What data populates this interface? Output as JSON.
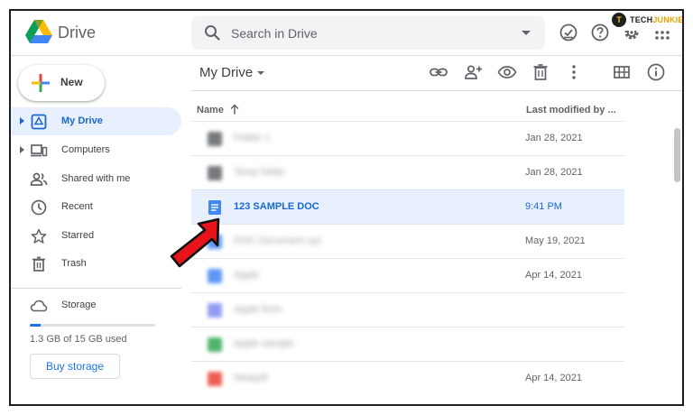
{
  "header": {
    "app_name": "Drive",
    "search_placeholder": "Search in Drive"
  },
  "watermark": {
    "mark": "T",
    "prefix": "TECH",
    "suffix": "JUNKIE"
  },
  "sidebar": {
    "new_label": "New",
    "items": [
      {
        "label": "My Drive",
        "icon": "my-drive-icon",
        "active": true
      },
      {
        "label": "Computers",
        "icon": "computers-icon"
      },
      {
        "label": "Shared with me",
        "icon": "shared-icon"
      },
      {
        "label": "Recent",
        "icon": "clock-icon"
      },
      {
        "label": "Starred",
        "icon": "star-icon"
      },
      {
        "label": "Trash",
        "icon": "trash-icon"
      }
    ],
    "storage_label": "Storage",
    "storage_used": "1.3 GB of 15 GB used",
    "storage_fraction": 0.087,
    "buy_storage": "Buy storage"
  },
  "main": {
    "title": "My Drive",
    "col_name": "Name",
    "col_modified": "Last modified by ...",
    "files": [
      {
        "name": "Folder 1",
        "type": "folder",
        "modified": "Jan 28, 2021",
        "blurred": true
      },
      {
        "name": "Temp folder",
        "type": "folder",
        "modified": "Jan 28, 2021",
        "blurred": true
      },
      {
        "name": "123 SAMPLE DOC",
        "type": "doc",
        "modified": "9:41 PM",
        "selected": true
      },
      {
        "name": "DOC Document xyz",
        "type": "doc",
        "modified": "May 19, 2021",
        "blurred": true
      },
      {
        "name": "Apple",
        "type": "doc",
        "modified": "Apr 14, 2021",
        "blurred": true
      },
      {
        "name": "Apple form",
        "type": "form",
        "modified": "",
        "blurred": true
      },
      {
        "name": "Apple sample",
        "type": "sheet",
        "modified": "",
        "blurred": true
      },
      {
        "name": "Newpdf",
        "type": "pdf",
        "modified": "Apr 14, 2021",
        "blurred": true
      }
    ]
  },
  "colors": {
    "accent": "#1a73e8",
    "selected_bg": "#e8f0fe",
    "doc": "#4285f4",
    "form": "#7e8ef0",
    "sheet": "#34a853",
    "pdf": "#ea4335",
    "folder": "#5f6368",
    "arrow": "#e8141b"
  }
}
